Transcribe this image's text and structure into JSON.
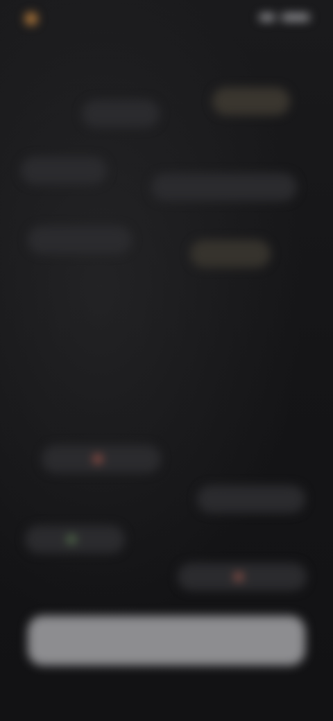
{
  "status_bar": {
    "app_name": "",
    "app_icon": "app-logo-icon",
    "right_icons": [
      "signal-icon",
      "battery-icon"
    ]
  },
  "header": {
    "heading": ""
  },
  "chips": [
    {
      "label": "",
      "dot_color": ""
    },
    {
      "label": "",
      "dot_color": ""
    },
    {
      "label": "",
      "dot_color": ""
    },
    {
      "label": "",
      "dot_color": ""
    },
    {
      "label": "",
      "dot_color": ""
    },
    {
      "label": "",
      "dot_color": ""
    },
    {
      "label": "",
      "dot_color": "#b4584a"
    },
    {
      "label": "",
      "dot_color": ""
    },
    {
      "label": "",
      "dot_color": "#5d7f52"
    },
    {
      "label": "",
      "dot_color": "#a65a4e"
    }
  ],
  "hero": {
    "eyebrow": "",
    "title": "",
    "description": ""
  },
  "cta": {
    "label": ""
  },
  "colors": {
    "background": "#141416",
    "chip_background": "#2b2b2e",
    "cta_background": "#8d8d90",
    "accent_orange": "#b77c3c"
  }
}
